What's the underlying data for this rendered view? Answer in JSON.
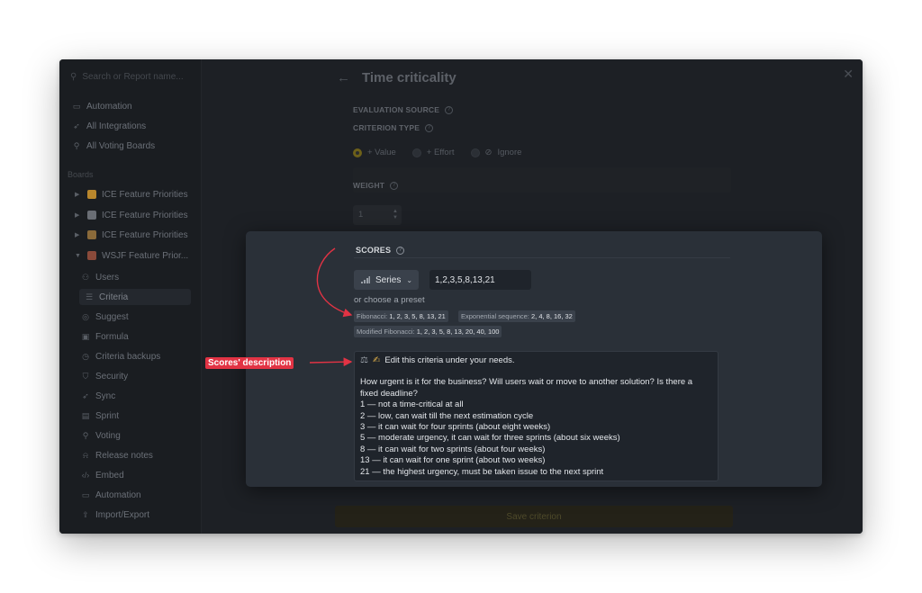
{
  "sidebar": {
    "search_placeholder": "Search or Report name...",
    "top_items": [
      {
        "label": "Automation",
        "icon": "calendar-icon"
      },
      {
        "label": "All Integrations",
        "icon": "rocket-icon"
      },
      {
        "label": "All Voting Boards",
        "icon": "pin-icon"
      }
    ],
    "section_label": "Boards",
    "boards": [
      {
        "label": "ICE Feature Priorities",
        "icon": "hand-emoji-icon",
        "color": "#b8862c"
      },
      {
        "label": "ICE Feature Priorities",
        "icon": "board-emoji-icon",
        "color": "#6a6e75"
      },
      {
        "label": "ICE Feature Priorities",
        "icon": "rocket-emoji-icon",
        "color": "#8a6a3a"
      },
      {
        "label": "WSJF Feature Prior...",
        "icon": "target-emoji-icon",
        "color": "#8a4a3a"
      }
    ],
    "sub_items": [
      {
        "label": "Users",
        "icon": "users-icon"
      },
      {
        "label": "Criteria",
        "icon": "criteria-icon"
      },
      {
        "label": "Suggest",
        "icon": "suggest-icon"
      },
      {
        "label": "Formula",
        "icon": "formula-icon"
      },
      {
        "label": "Criteria backups",
        "icon": "backup-icon"
      },
      {
        "label": "Security",
        "icon": "shield-icon"
      },
      {
        "label": "Sync",
        "icon": "sync-icon"
      },
      {
        "label": "Sprint",
        "icon": "sprint-icon"
      },
      {
        "label": "Voting",
        "icon": "voting-icon"
      },
      {
        "label": "Release notes",
        "icon": "bell-icon"
      },
      {
        "label": "Embed",
        "icon": "code-icon"
      },
      {
        "label": "Automation",
        "icon": "calendar-icon"
      },
      {
        "label": "Import/Export",
        "icon": "import-icon"
      }
    ]
  },
  "main": {
    "title": "Time criticality",
    "evaluation_source_label": "EVALUATION SOURCE",
    "criterion_type_label": "CRITERION TYPE",
    "criterion_options": [
      {
        "label": "+ Value",
        "selected": true
      },
      {
        "label": "+ Effort",
        "selected": false
      },
      {
        "label": "Ignore",
        "selected": false
      }
    ],
    "weight_label": "WEIGHT",
    "weight_value": "1",
    "save_button": "Save criterion"
  },
  "scores": {
    "label": "SCORES",
    "series_button": "Series",
    "series_value": "1,2,3,5,8,13,21",
    "preset_label": "or choose a preset",
    "presets": [
      {
        "name": "Fibonacci:",
        "values": "1, 2, 3, 5, 8, 13, 21"
      },
      {
        "name": "Exponential sequence:",
        "values": "2, 4, 8, 16, 32"
      },
      {
        "name": "Modified Fibonacci:",
        "values": "1, 2, 3, 5, 8, 13, 20, 40, 100"
      }
    ],
    "description": {
      "header": "Edit this criteria under your needs.",
      "question": "How urgent is it for the business? Will users wait or move to another solution? Is there a fixed deadline?",
      "lines": [
        "1 — not a time-critical at all",
        "2 — low, can wait till the next estimation cycle",
        "3 — it can wait for four sprints (about eight weeks)",
        "5 — moderate urgency, it can wait for three sprints (about six weeks)",
        "8 — it can wait for two sprints (about four weeks)",
        "13 — it can wait for one sprint (about two weeks)",
        "21 — the highest urgency, must be taken issue to the next sprint"
      ]
    }
  },
  "annotation": {
    "label": "Scores' description",
    "color": "#e23344"
  }
}
